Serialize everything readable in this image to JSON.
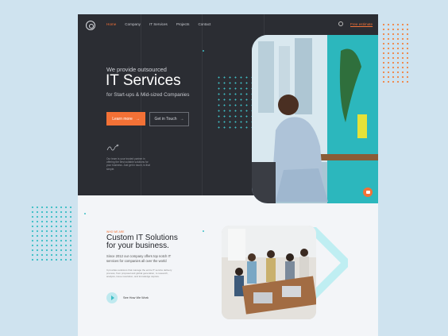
{
  "nav": {
    "items": [
      "Home",
      "Company",
      "IT Services",
      "Projects",
      "Contact"
    ],
    "active_index": 0,
    "cta": "Free estimate"
  },
  "hero": {
    "eyebrow": "We provide outsourced",
    "title": "IT Services",
    "subtitle": "for Start-ups & Mid-sized Companies",
    "primary_button": "Learn more",
    "secondary_button": "Get in Touch",
    "tagline": "Our team is your trusted partner in offering the best suitable solutions for your business. Just get in touch, is that simple."
  },
  "section": {
    "label": "WHO WE ARE",
    "heading_line1": "Custom IT Solutions",
    "heading_line2": "for your business.",
    "paragraph": "Since 2012 our company offers top notch IT services for companies all over the world",
    "paragraph_small": "It provides solutions that manage the entire IT service delivery process, from proposal and global generation, to research, analysis, issue resolution, and knowledge capture.",
    "video_link": "See How We Work"
  },
  "colors": {
    "accent": "#f37136",
    "teal": "#3fbfc6",
    "dark": "#2b2d33",
    "page_bg": "#cfe3ef"
  }
}
